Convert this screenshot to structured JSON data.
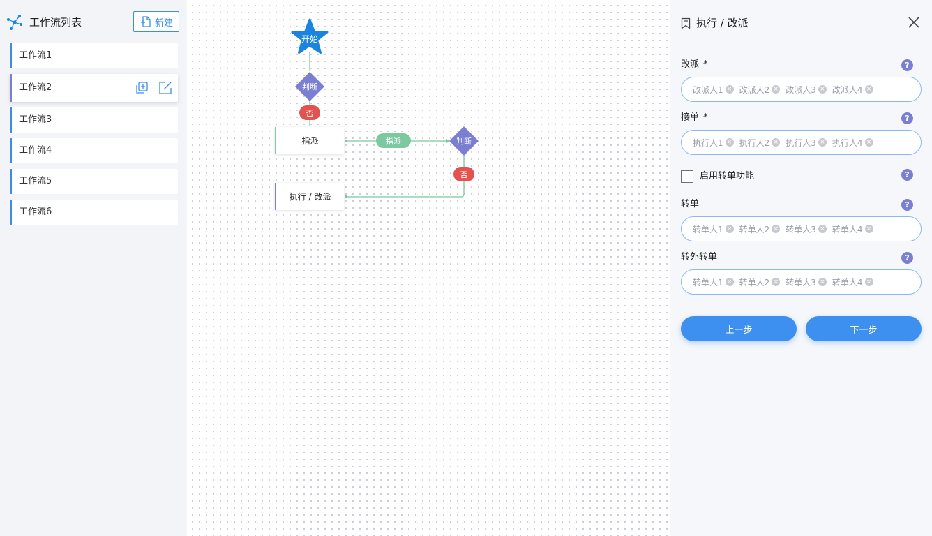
{
  "sidebar": {
    "title": "工作流列表",
    "new_button": "新建",
    "items": [
      {
        "label": "工作流1"
      },
      {
        "label": "工作流2"
      },
      {
        "label": "工作流3"
      },
      {
        "label": "工作流4"
      },
      {
        "label": "工作流5"
      },
      {
        "label": "工作流6"
      }
    ]
  },
  "flow": {
    "start": "开始",
    "decision_1": "判断",
    "no_1": "否",
    "assign_node": "指派",
    "edge_assign": "指派",
    "decision_2": "判断",
    "no_2": "否",
    "exec_node": "执行 / 改派"
  },
  "panel": {
    "title": "执行 / 改派",
    "help_glyph": "?",
    "required_mark": "*",
    "fields": {
      "reassign": {
        "label": "改派",
        "tags": [
          "改派人1",
          "改派人2",
          "改派人3",
          "改派人4"
        ]
      },
      "accept": {
        "label": "接单",
        "tags": [
          "执行人1",
          "执行人2",
          "执行人3",
          "执行人4"
        ]
      },
      "enable_transfer": {
        "label": "启用转单功能",
        "checked": false
      },
      "transfer": {
        "label": "转单",
        "tags": [
          "转单人1",
          "转单人2",
          "转单人3",
          "转单人4"
        ]
      },
      "external_transfer": {
        "label": "转外转单",
        "tags": [
          "转单人1",
          "转单人2",
          "转单人3",
          "转单人4"
        ]
      }
    },
    "prev_button": "上一步",
    "next_button": "下一步"
  },
  "colors": {
    "accent": "#3d8ff0",
    "decision": "#7b7fd1",
    "no_badge": "#e4524f",
    "edge": "#7cc8a0",
    "start": "#1a84e0"
  }
}
